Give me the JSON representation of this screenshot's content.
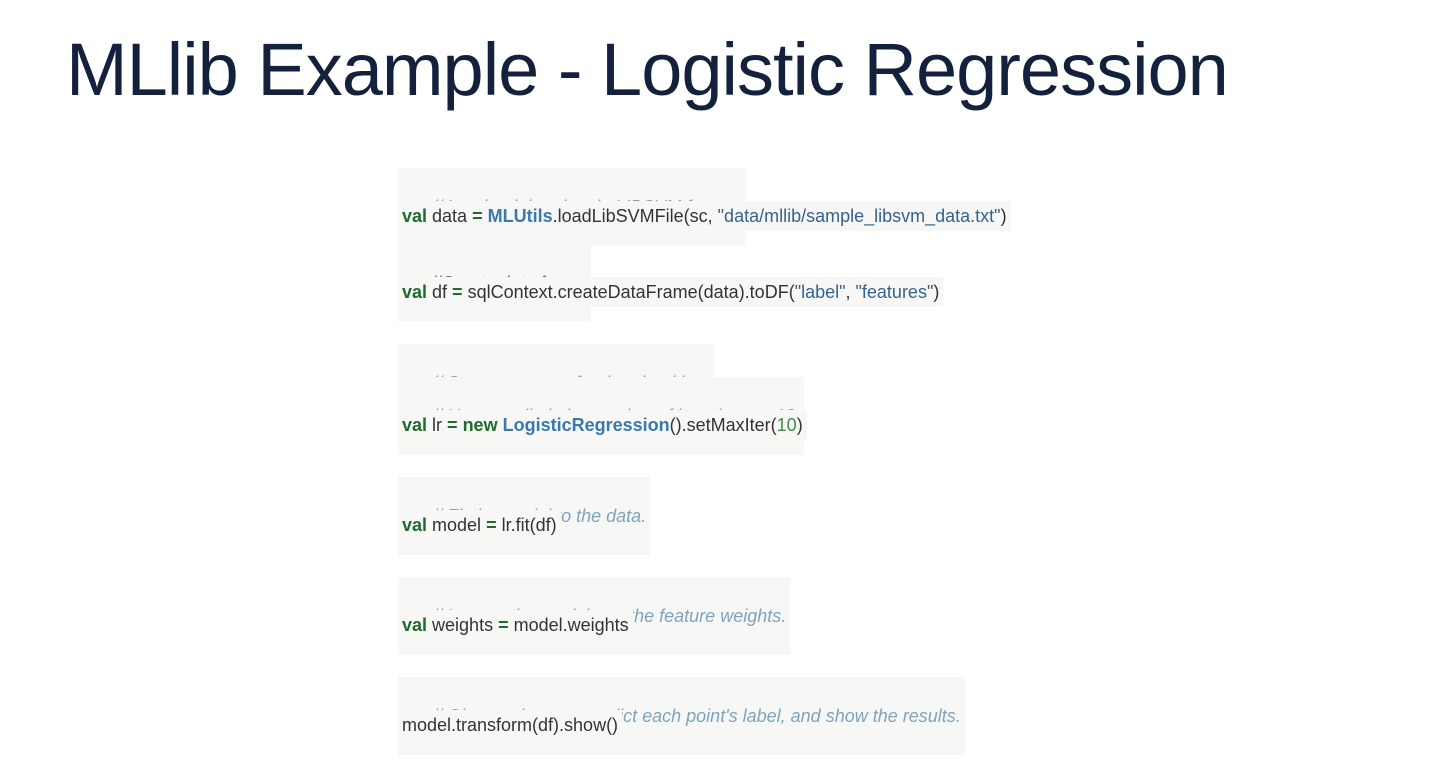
{
  "slide": {
    "title": "MLlib Example - Logistic Regression"
  },
  "code": {
    "line1": {
      "comment": "// Load training data in LIBSVM format."
    },
    "line2": {
      "kw_val": "val",
      "name": " data ",
      "op": "=",
      "space": " ",
      "cls": "MLUtils",
      "call": ".loadLibSVMFile(sc, ",
      "str": "\"data/mllib/sample_libsvm_data.txt\"",
      "close": ")"
    },
    "line3": {
      "comment": "//Create data frame"
    },
    "line4": {
      "kw_val": "val",
      "name": " df ",
      "op": "=",
      "call": " sqlContext.createDataFrame(data).toDF(",
      "str1": "\"label\"",
      "sep": ", ",
      "str2": "\"features\"",
      "close": ")"
    },
    "line5": {
      "comment": "// Set parameters for the algorithm."
    },
    "line6": {
      "comment": "// Here, we limit the number of iterations to 10."
    },
    "line7": {
      "kw_val": "val",
      "name": " lr ",
      "op": "=",
      "space": " ",
      "kw_new": "new",
      "space2": " ",
      "cls": "LogisticRegression",
      "call": "().setMaxIter(",
      "num": "10",
      "close": ")"
    },
    "line8": {
      "comment": "// Fit the model to the data."
    },
    "line9": {
      "kw_val": "val",
      "name": " model ",
      "op": "=",
      "call": " lr.fit(df)"
    },
    "line10": {
      "comment": "// Inspect the model: get the feature weights."
    },
    "line11": {
      "kw_val": "val",
      "name": " weights ",
      "op": "=",
      "call": " model.weights"
    },
    "line12": {
      "comment": "// Given a dataset, predict each point's label, and show the results."
    },
    "line13": {
      "call": "model.transform(df).show()"
    }
  },
  "colors": {
    "title": "#14213d",
    "comment": "#7fa3bd",
    "keyword": "#1f6b2e",
    "class": "#3a78b0",
    "string": "#35628d",
    "number": "#3f8a4e",
    "code_background": "#f7f8f6"
  }
}
